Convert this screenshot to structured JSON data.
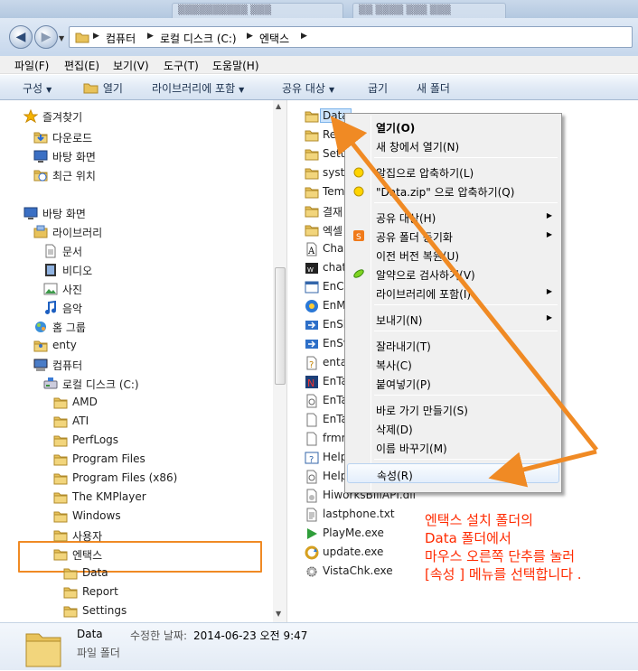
{
  "window": {
    "tabs": [
      "▒▒▒▒▒▒▒▒▒▒ ▒▒▒",
      "▒▒ ▒▒▒▒ ▒▒▒ ▒▒▒"
    ]
  },
  "address": {
    "crumbs": [
      "컴퓨터",
      "로컬 디스크 (C:)",
      "엔택스"
    ]
  },
  "menubar": [
    "파일(F)",
    "편집(E)",
    "보기(V)",
    "도구(T)",
    "도움말(H)"
  ],
  "toolbar": {
    "organize": "구성",
    "open": "열기",
    "include_library": "라이브러리에 포함",
    "share_with": "공유 대상",
    "burn": "굽기",
    "new_folder": "새 폴더"
  },
  "navpane": {
    "items": [
      {
        "label": "즐겨찾기",
        "icon": "star-icon"
      },
      {
        "label": "다운로드",
        "icon": "downloads-folder-icon"
      },
      {
        "label": "바탕 화면",
        "icon": "desktop-icon"
      },
      {
        "label": "최근 위치",
        "icon": "recent-places-icon"
      },
      {
        "label": "바탕 화면",
        "icon": "desktop-icon"
      },
      {
        "label": "라이브러리",
        "icon": "library-icon"
      },
      {
        "label": "문서",
        "icon": "documents-icon"
      },
      {
        "label": "비디오",
        "icon": "video-icon"
      },
      {
        "label": "사진",
        "icon": "pictures-icon"
      },
      {
        "label": "음악",
        "icon": "music-icon"
      },
      {
        "label": "홈 그룹",
        "icon": "homegroup-icon"
      },
      {
        "label": "enty",
        "icon": "user-folder-icon"
      },
      {
        "label": "컴퓨터",
        "icon": "computer-icon"
      },
      {
        "label": "로컬 디스크 (C:)",
        "icon": "drive-icon"
      },
      {
        "label": "AMD",
        "icon": "folder-icon"
      },
      {
        "label": "ATI",
        "icon": "folder-icon"
      },
      {
        "label": "PerfLogs",
        "icon": "folder-icon"
      },
      {
        "label": "Program Files",
        "icon": "folder-icon"
      },
      {
        "label": "Program Files (x86)",
        "icon": "folder-icon"
      },
      {
        "label": "The KMPlayer",
        "icon": "folder-icon"
      },
      {
        "label": "Windows",
        "icon": "folder-icon"
      },
      {
        "label": "사용자",
        "icon": "folder-icon"
      },
      {
        "label": "엔택스",
        "icon": "folder-icon"
      },
      {
        "label": "Data",
        "icon": "folder-icon"
      },
      {
        "label": "Report",
        "icon": "folder-icon"
      },
      {
        "label": "Settings",
        "icon": "folder-icon"
      }
    ]
  },
  "files": [
    {
      "label": "Data",
      "icon": "folder-icon"
    },
    {
      "label": "Re",
      "icon": "folder-icon"
    },
    {
      "label": "Sett",
      "icon": "folder-icon"
    },
    {
      "label": "syste",
      "icon": "folder-icon"
    },
    {
      "label": "Tem",
      "icon": "folder-icon"
    },
    {
      "label": "결재",
      "icon": "folder-icon"
    },
    {
      "label": "엑셀",
      "icon": "folder-icon"
    },
    {
      "label": "Char",
      "icon": "font-file-icon"
    },
    {
      "label": "chat",
      "icon": "chat-app-icon"
    },
    {
      "label": "EnCa",
      "icon": "window-app-icon"
    },
    {
      "label": "EnM",
      "icon": "globe-app-icon"
    },
    {
      "label": "EnSh",
      "icon": "shortcut-app-icon"
    },
    {
      "label": "EnSv",
      "icon": "shortcut-app-icon"
    },
    {
      "label": "enta",
      "icon": "help-file-icon"
    },
    {
      "label": "EnTa",
      "icon": "n-app-icon"
    },
    {
      "label": "EnTa",
      "icon": "settings-file-icon"
    },
    {
      "label": "EnTa",
      "icon": "blank-file-icon"
    },
    {
      "label": "frmr",
      "icon": "blank-file-icon"
    },
    {
      "label": "Help",
      "icon": "help-app-icon"
    },
    {
      "label": "Help",
      "icon": "settings-file-icon"
    },
    {
      "label": "HiworksBillAPI.dll",
      "icon": "dll-file-icon"
    },
    {
      "label": "lastphone.txt",
      "icon": "text-file-icon"
    },
    {
      "label": "PlayMe.exe",
      "icon": "play-app-icon"
    },
    {
      "label": "update.exe",
      "icon": "update-app-icon"
    },
    {
      "label": "VistaChk.exe",
      "icon": "gear-app-icon"
    }
  ],
  "context_menu": {
    "items": [
      {
        "label": "열기(O)",
        "bold": true
      },
      {
        "label": "새 창에서 열기(N)"
      },
      {
        "sep": true
      },
      {
        "label": "알집으로 압축하기(L)",
        "icon": "alzip-icon"
      },
      {
        "label": "\"Data.zip\" 으로 압축하기(Q)",
        "icon": "alzip-icon"
      },
      {
        "sep": true
      },
      {
        "label": "공유 대상(H)",
        "submenu": true
      },
      {
        "label": "공유 폴더 동기화",
        "submenu": true,
        "icon": "sync-icon"
      },
      {
        "label": "이전 버전 복원(U)"
      },
      {
        "label": "알약으로 검사하기(V)",
        "icon": "alyac-icon"
      },
      {
        "label": "라이브러리에 포함(I)",
        "submenu": true
      },
      {
        "sep": true
      },
      {
        "label": "보내기(N)",
        "submenu": true
      },
      {
        "sep": true
      },
      {
        "label": "잘라내기(T)"
      },
      {
        "label": "복사(C)"
      },
      {
        "label": "붙여넣기(P)"
      },
      {
        "sep": true
      },
      {
        "label": "바로 가기 만들기(S)"
      },
      {
        "label": "삭제(D)"
      },
      {
        "label": "이름 바꾸기(M)"
      },
      {
        "sep": true
      },
      {
        "label": "속성(R)",
        "hot": true
      }
    ]
  },
  "details": {
    "name": "Data",
    "modified_label": "수정한 날짜:",
    "modified_value": "2014-06-23 오전 9:47",
    "type": "파일 폴더"
  },
  "annotation": {
    "lines": [
      "엔택스 설치 폴더의",
      "Data 폴더에서",
      "마우스 오른쪽 단추를 눌러",
      "[속성 ] 메뉴를 선택합니다 ."
    ],
    "color": "#ff2a00",
    "arrow_color": "#f08a24"
  },
  "colors": {
    "selection": "#cce4fc",
    "highlight_box": "#f08a24",
    "folder": "#e8c25a"
  }
}
